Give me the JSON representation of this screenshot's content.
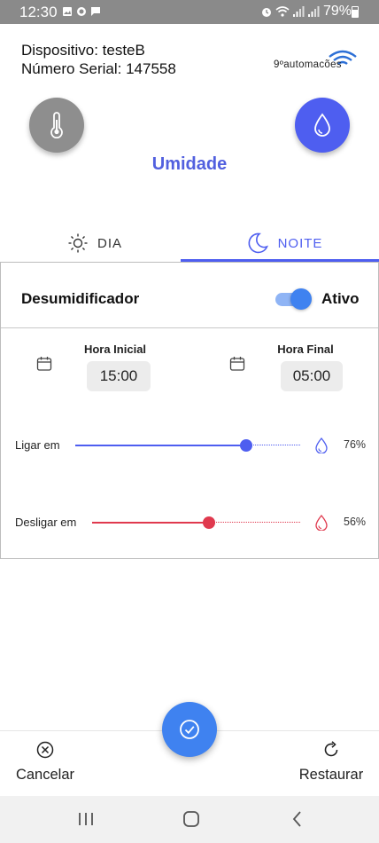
{
  "status_bar": {
    "time": "12:30",
    "battery": "79%",
    "left_icons": [
      "image-icon",
      "signal-app-icon",
      "message-icon"
    ],
    "right_icons": [
      "alarm-icon",
      "wifi-icon",
      "signal-icon",
      "signal-icon"
    ]
  },
  "device": {
    "name_line": "Dispositivo: testeB",
    "serial_line": "Número Serial: 147558",
    "brand": "9ºautomacões"
  },
  "modes": {
    "temperature_icon": "thermometer-icon",
    "humidity_icon": "water-drop-icon",
    "active_title": "Umidade"
  },
  "tabs": [
    {
      "label": "DIA",
      "icon": "sun-icon",
      "active": false
    },
    {
      "label": "NOITE",
      "icon": "moon-icon",
      "active": true
    }
  ],
  "card": {
    "title": "Desumidificador",
    "toggle_on": true,
    "toggle_label": "Ativo",
    "start_label": "Hora Inicial",
    "start_time": "15:00",
    "end_label": "Hora Final",
    "end_time": "05:00",
    "sliders": [
      {
        "label": "Ligar em",
        "value_text": "76%",
        "level": 0.76,
        "color": "#4e5ef0"
      },
      {
        "label": "Desligar em",
        "value_text": "56%",
        "level": 0.56,
        "color": "#e0394e"
      }
    ]
  },
  "actions": {
    "cancel_label": "Cancelar",
    "restore_label": "Restaurar",
    "confirm_icon": "check-circle-icon"
  },
  "colors": {
    "primary": "#4e5ef0",
    "accent_blue": "#3f82f0",
    "inactive_gray": "#8e8e8e",
    "danger": "#e0394e"
  }
}
